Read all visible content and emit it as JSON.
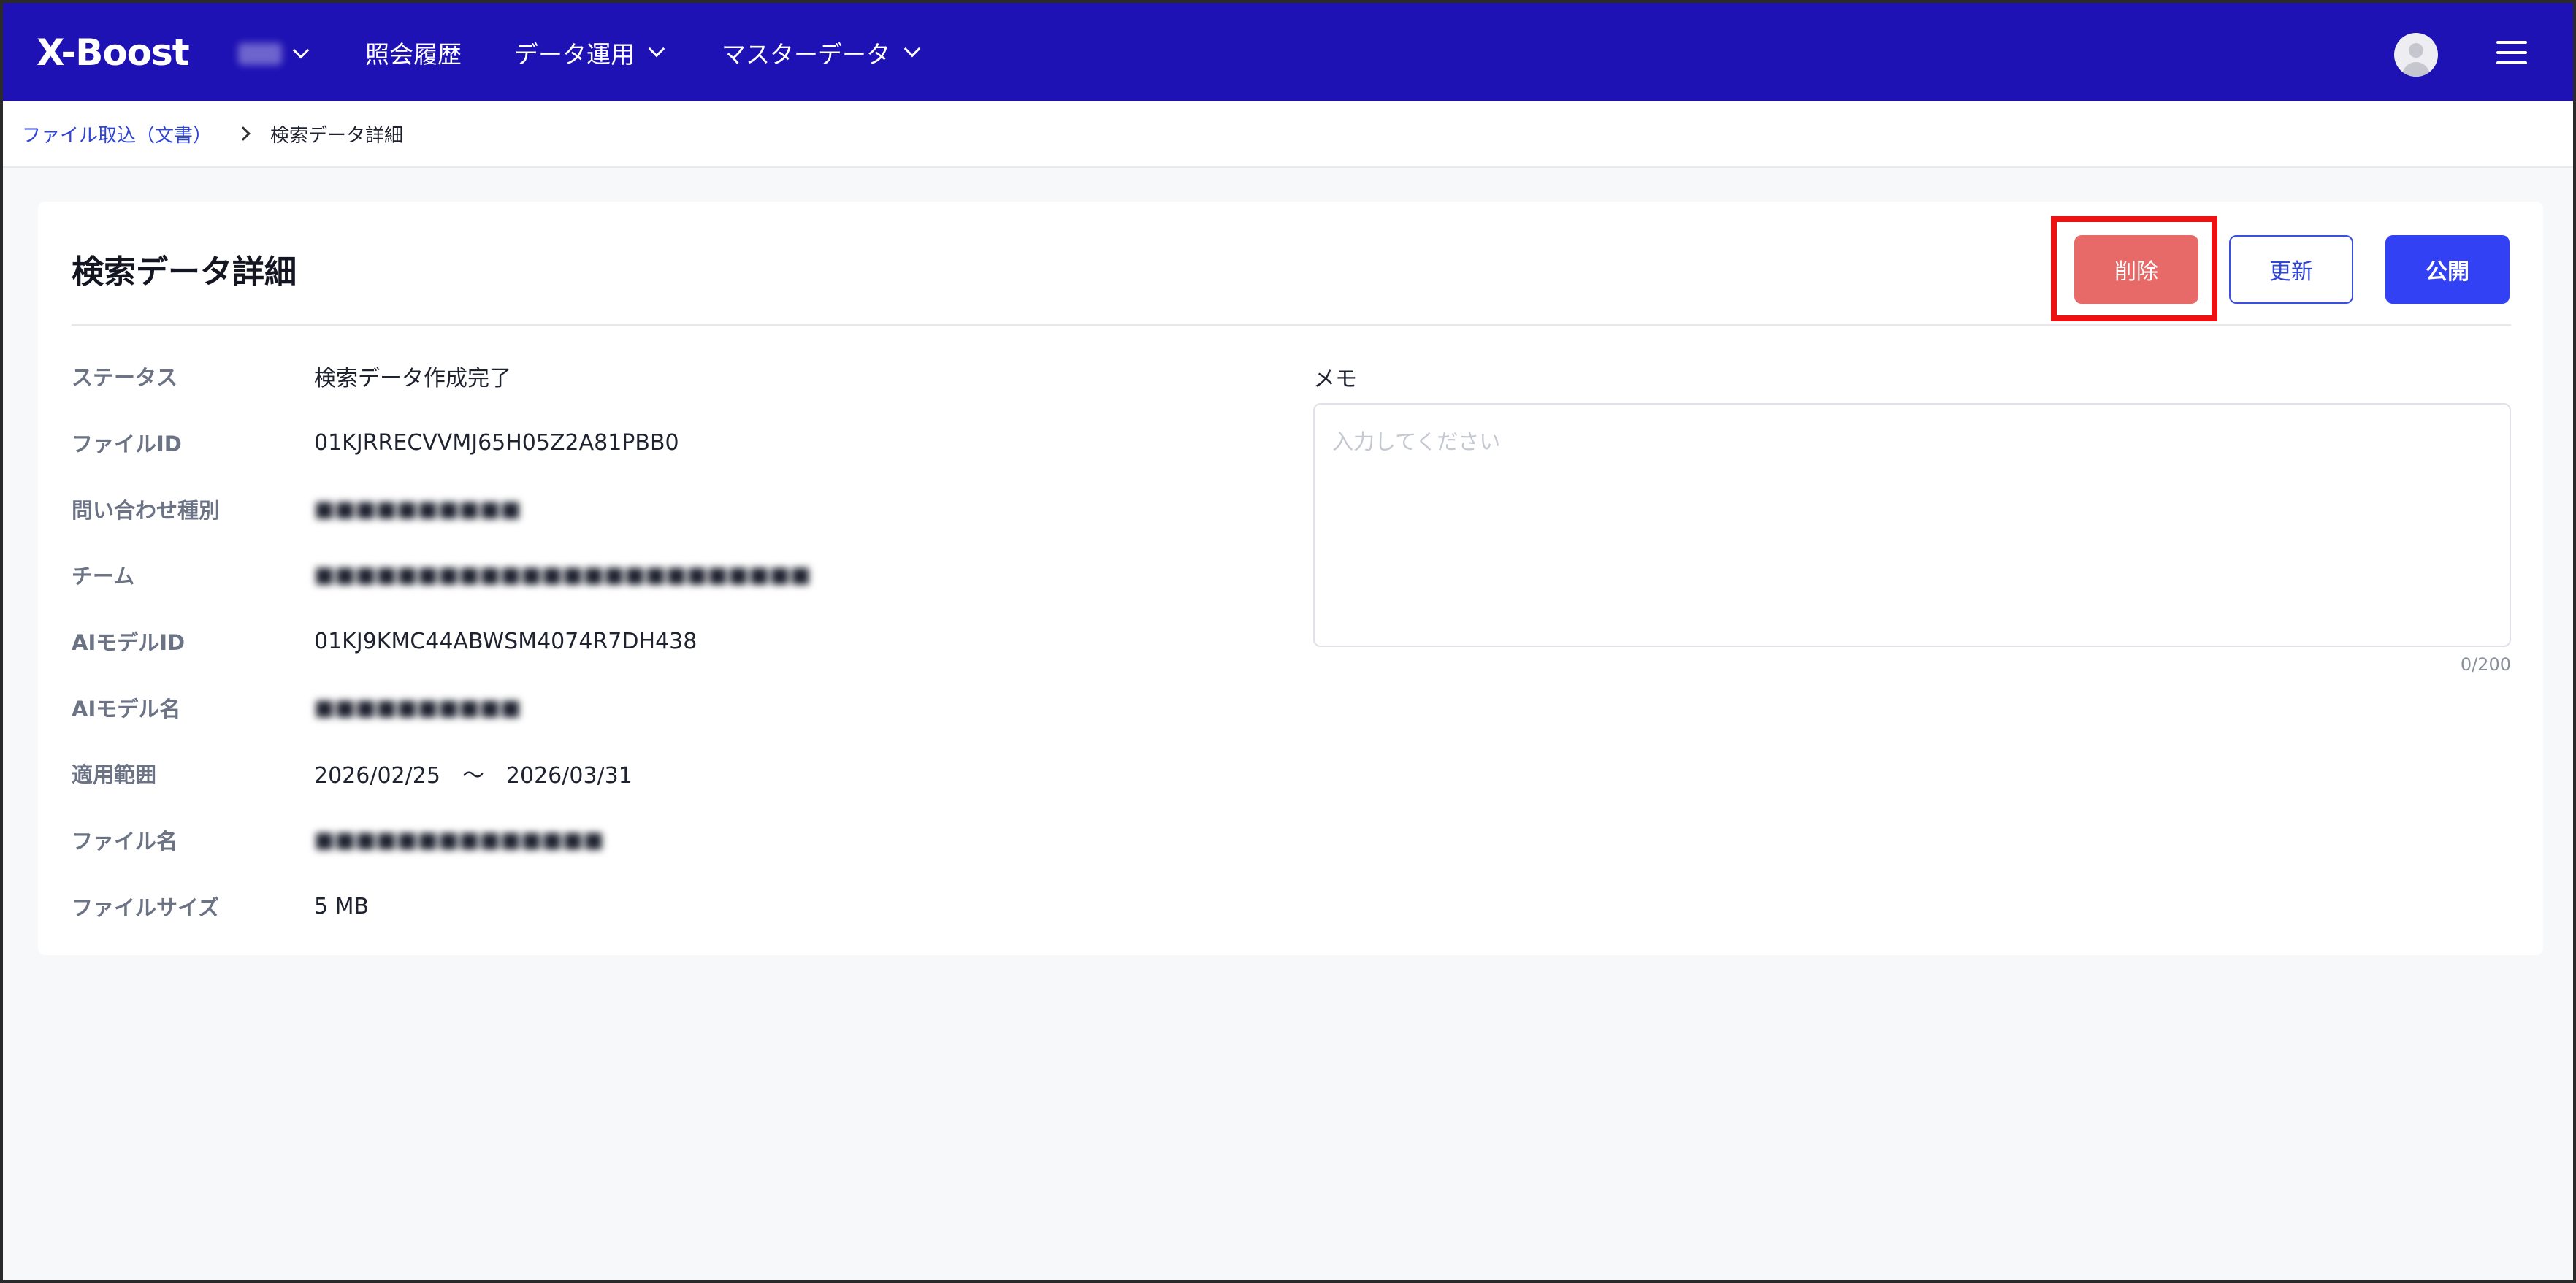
{
  "header": {
    "logo_text": "X-Boost",
    "nav": [
      {
        "label": "照会履歴",
        "dropdown": false
      },
      {
        "label": "データ運用",
        "dropdown": true
      },
      {
        "label": "マスターデータ",
        "dropdown": true
      }
    ],
    "colors": {
      "bar": "#1f12b4"
    }
  },
  "breadcrumb": {
    "parent": "ファイル取込（文書）",
    "current": "検索データ詳細"
  },
  "page": {
    "title": "検索データ詳細",
    "buttons": {
      "delete": "削除",
      "update": "更新",
      "publish": "公開"
    }
  },
  "details": [
    {
      "label": "ステータス",
      "value": "検索データ作成完了",
      "blurred": false
    },
    {
      "label": "ファイルID",
      "value": "01KJRRECVVMJ65H05Z2A81PBB0",
      "blurred": false
    },
    {
      "label": "問い合わせ種別",
      "value": "",
      "blurred": true
    },
    {
      "label": "チーム",
      "value": "",
      "blurred": true
    },
    {
      "label": "AIモデルID",
      "value": "01KJ9KMC44ABWSM4074R7DH438",
      "blurred": false
    },
    {
      "label": "AIモデル名",
      "value": "",
      "blurred": true
    },
    {
      "label": "適用範囲",
      "value": "2026/02/25　～　2026/03/31",
      "blurred": false
    },
    {
      "label": "ファイル名",
      "value": "",
      "blurred": true
    },
    {
      "label": "ファイルサイズ",
      "value": "5 MB",
      "blurred": false
    }
  ],
  "memo": {
    "label": "メモ",
    "placeholder": "入力してください",
    "value": "",
    "counter": "0/200"
  }
}
